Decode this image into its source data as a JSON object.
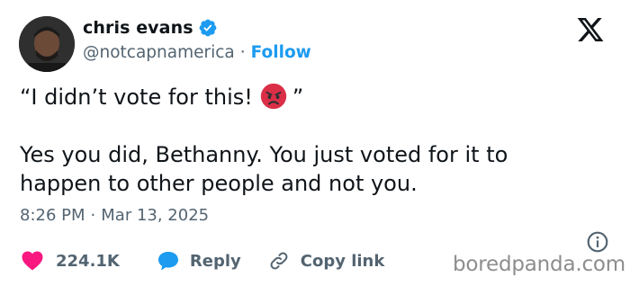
{
  "author": {
    "display_name": "chris evans",
    "handle": "@notcapnamerica",
    "separator": "·",
    "follow_label": "Follow",
    "verified_icon": "verified-badge-icon",
    "avatar": "profile-avatar"
  },
  "tweet": {
    "line1_before_emoji": "“I didn’t vote for this!",
    "emoji": "angry-face-emoji",
    "line1_after_emoji": "”",
    "line2": "Yes you did, Bethanny. You just voted for it to",
    "line3": "happen to other people and not you."
  },
  "meta": {
    "time": "8:26 PM",
    "separator": "·",
    "date": "Mar 13, 2025"
  },
  "actions": {
    "like_count": "224.1K",
    "reply_label": "Reply",
    "copy_link_label": "Copy link"
  },
  "icons": {
    "x_logo": "x-logo-icon",
    "info": "info-icon",
    "heart": "heart-icon",
    "reply": "speech-bubble-icon",
    "link": "link-icon"
  },
  "colors": {
    "accent_blue": "#1d9bf0",
    "heart_pink": "#f91880",
    "secondary_text": "#536471",
    "primary_text": "#0f1419"
  },
  "watermark": "boredpanda.com"
}
